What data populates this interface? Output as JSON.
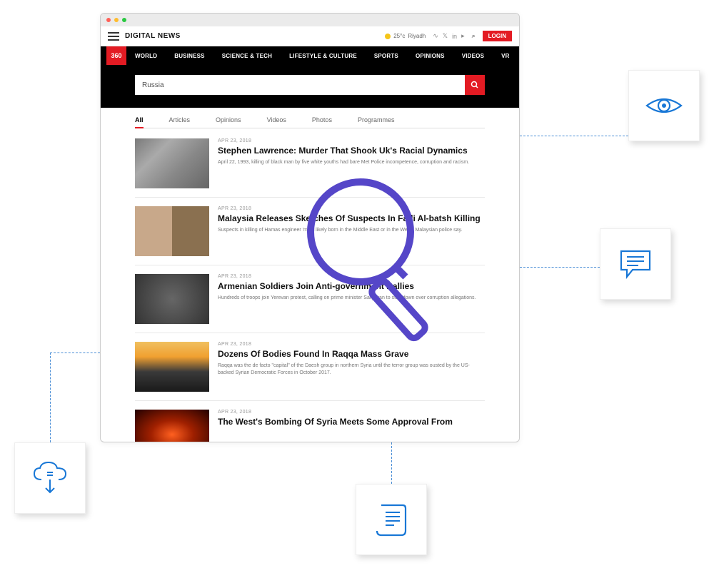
{
  "header": {
    "brand": "DIGITAL NEWS",
    "weather": {
      "temp": "25°c",
      "city": "Riyadh"
    },
    "login": "LOGIN"
  },
  "nav": {
    "logo": "360",
    "items": [
      "WORLD",
      "BUSINESS",
      "SCIENCE & TECH",
      "LIFESTYLE & CULTURE",
      "SPORTS",
      "OPINIONS",
      "VIDEOS",
      "VR"
    ]
  },
  "search": {
    "value": "Russia"
  },
  "tabs": [
    "All",
    "Articles",
    "Opinions",
    "Videos",
    "Photos",
    "Programmes"
  ],
  "active_tab": 0,
  "articles": [
    {
      "date": "APR 23, 2018",
      "title": "Stephen Lawrence: Murder That Shook Uk's Racial Dynamics",
      "desc": "April 22, 1993, killing of black man by five white youths had bare Met Police incompetence, corruption and racism."
    },
    {
      "date": "APR 23, 2018",
      "title": "Malaysia Releases Sketches Of Suspects In Fadi Al-batsh Killing",
      "desc": "Suspects in killing of Hamas engineer 'most likely born in the Middle East or in the West', Malaysian police say."
    },
    {
      "date": "APR 23, 2018",
      "title": "Armenian Soldiers Join Anti-government Rallies",
      "desc": "Hundreds of troops join Yerevan protest, calling on prime minister Sargsyan to step down over corruption allegations."
    },
    {
      "date": "APR 23, 2018",
      "title": "Dozens Of Bodies Found In Raqqa Mass Grave",
      "desc": "Raqqa was the de facto \"capital\" of the Daesh group in northern Syria until the terror group was ousted by the US-backed Syrian Democratic Forces in October 2017."
    },
    {
      "date": "APR 23, 2018",
      "title": "The West's Bombing Of Syria Meets Some Approval From",
      "desc": ""
    }
  ]
}
